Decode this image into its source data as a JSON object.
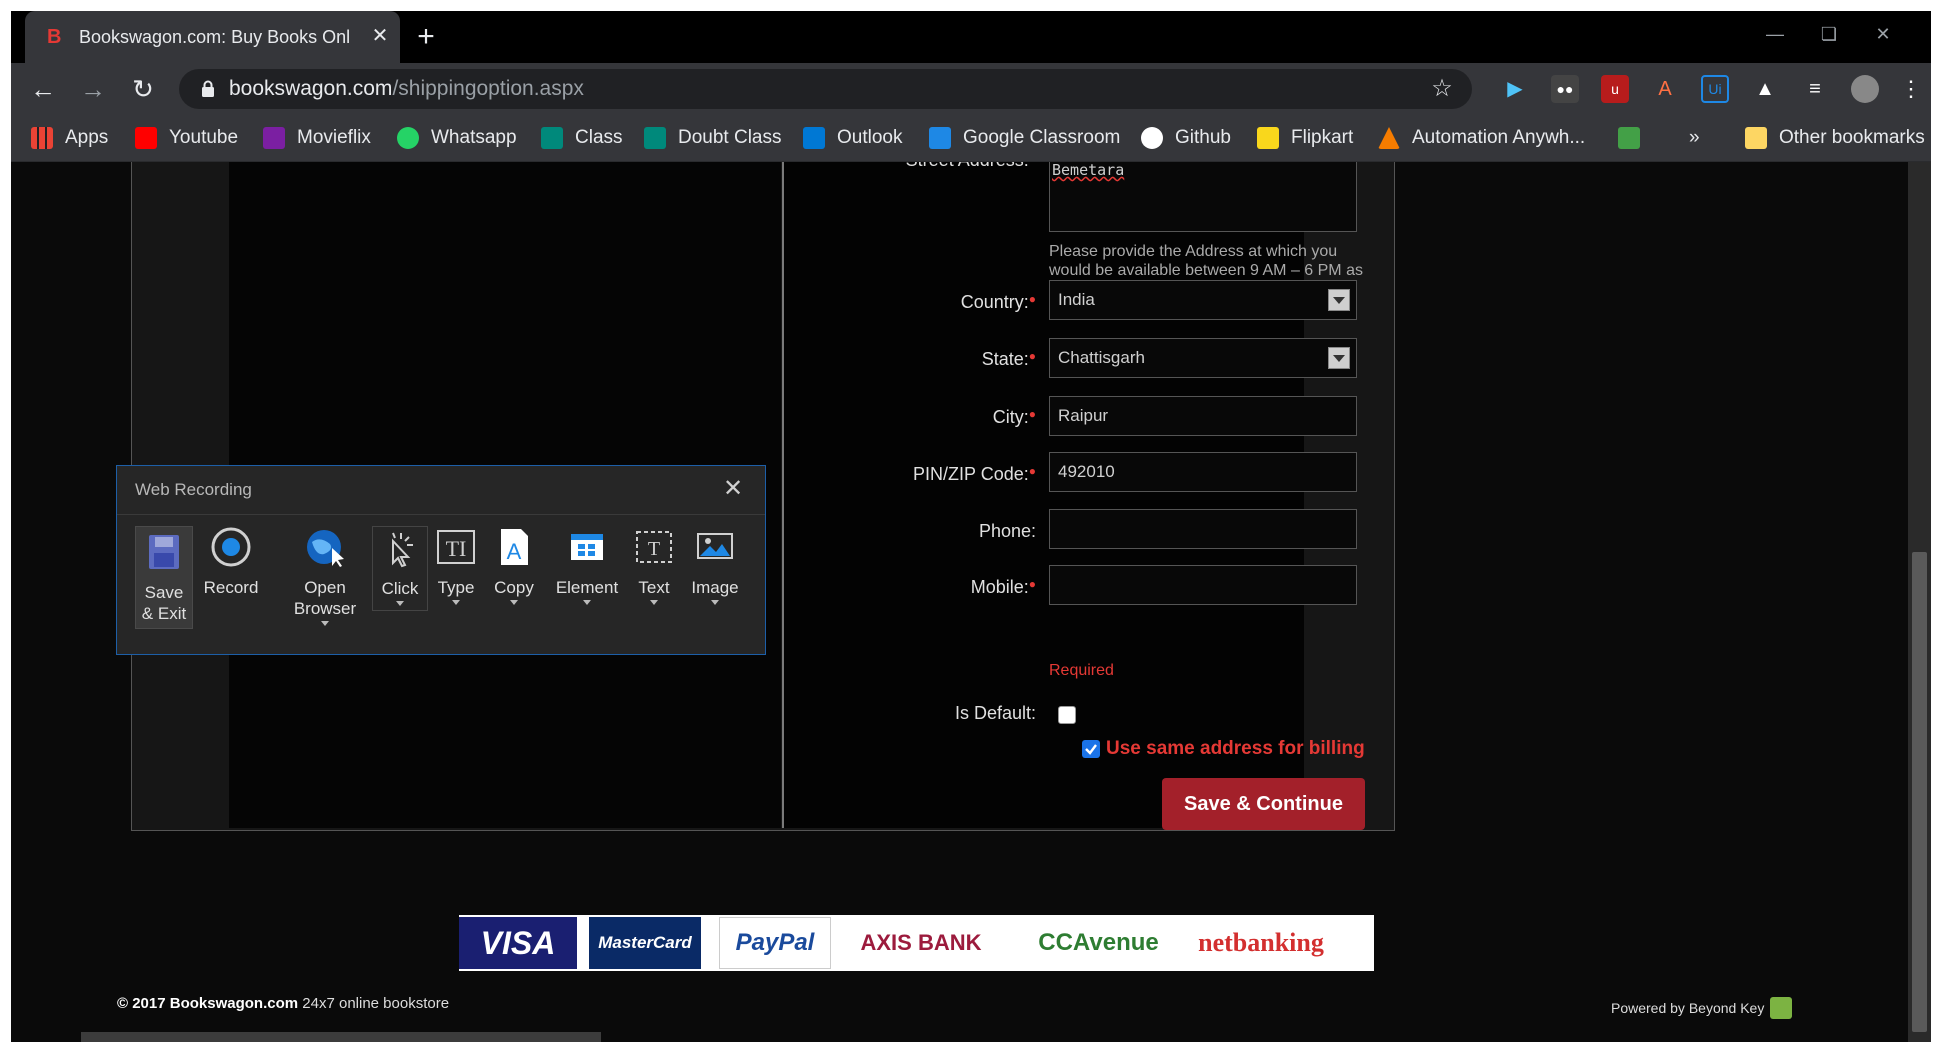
{
  "browser": {
    "tab_title": "Bookswagon.com: Buy Books Onl",
    "tab_close": "✕",
    "new_tab": "+",
    "url_domain": "bookswagon.com",
    "url_path": "/shippingoption.aspx"
  },
  "bookmarks": [
    {
      "label": "Apps",
      "icon": "apps-grid-icon",
      "color": "#4285f4"
    },
    {
      "label": "Youtube",
      "icon": "youtube-icon",
      "color": "#ff0000"
    },
    {
      "label": "Movieflix",
      "icon": "movieflix-icon",
      "color": "#7b1fa2"
    },
    {
      "label": "Whatsapp",
      "icon": "whatsapp-icon",
      "color": "#25d366"
    },
    {
      "label": "Class",
      "icon": "meet-icon",
      "color": "#00897b"
    },
    {
      "label": "Doubt Class",
      "icon": "meet-icon",
      "color": "#00897b"
    },
    {
      "label": "Outlook",
      "icon": "outlook-icon",
      "color": "#0078d4"
    },
    {
      "label": "Google Classroom",
      "icon": "classroom-icon",
      "color": "#1e88e5"
    },
    {
      "label": "Github",
      "icon": "github-icon",
      "color": "#ffffff"
    },
    {
      "label": "Flipkart",
      "icon": "flipkart-icon",
      "color": "#f9d71c"
    },
    {
      "label": "Automation Anywh...",
      "icon": "automation-anywhere-icon",
      "color": "#f57c00"
    }
  ],
  "bookmarks_overflow": "»",
  "other_bookmarks": "Other bookmarks",
  "form": {
    "street_label": "Street Address:",
    "street_value": "Bemetara",
    "address_help": "Please provide the Address at which you would be available between 9 AM – 6 PM as our Courier partners deliver between this time",
    "country_label": "Country:",
    "country_value": "India",
    "state_label": "State:",
    "state_value": "Chattisgarh",
    "city_label": "City:",
    "city_value": "Raipur",
    "pin_label": "PIN/ZIP Code:",
    "pin_value": "492010",
    "phone_label": "Phone:",
    "phone_value": "",
    "mobile_label": "Mobile:",
    "mobile_value": "",
    "mobile_error": "Required",
    "default_label": "Is Default:",
    "is_default": false,
    "billing_label": "Use same address for billing",
    "use_same_billing": true,
    "submit_label": "Save & Continue",
    "required_mark": "●"
  },
  "payments": [
    "VISA",
    "MasterCard",
    "PayPal",
    "AXIS BANK",
    "CCAvenue",
    "netbanking"
  ],
  "footer": {
    "copyright_bold": "© 2017 Bookswagon.com",
    "copyright_rest": " 24x7 online bookstore",
    "powered": "Powered by Beyond Key"
  },
  "recorder": {
    "title": "Web Recording",
    "close": "✕",
    "tools": [
      {
        "label": "Save\n& Exit",
        "icon": "save-icon"
      },
      {
        "label": "Record",
        "icon": "record-icon"
      },
      {
        "label": "Open\nBrowser",
        "icon": "globe-cursor-icon"
      },
      {
        "label": "Click",
        "icon": "click-icon"
      },
      {
        "label": "Type",
        "icon": "type-icon"
      },
      {
        "label": "Copy",
        "icon": "copy-icon"
      },
      {
        "label": "Element",
        "icon": "element-icon"
      },
      {
        "label": "Text",
        "icon": "text-icon"
      },
      {
        "label": "Image",
        "icon": "image-icon"
      }
    ]
  },
  "colors": {
    "accent_red": "#a3202a",
    "error_red": "#e53935",
    "panel_border": "#1d5fa8"
  }
}
